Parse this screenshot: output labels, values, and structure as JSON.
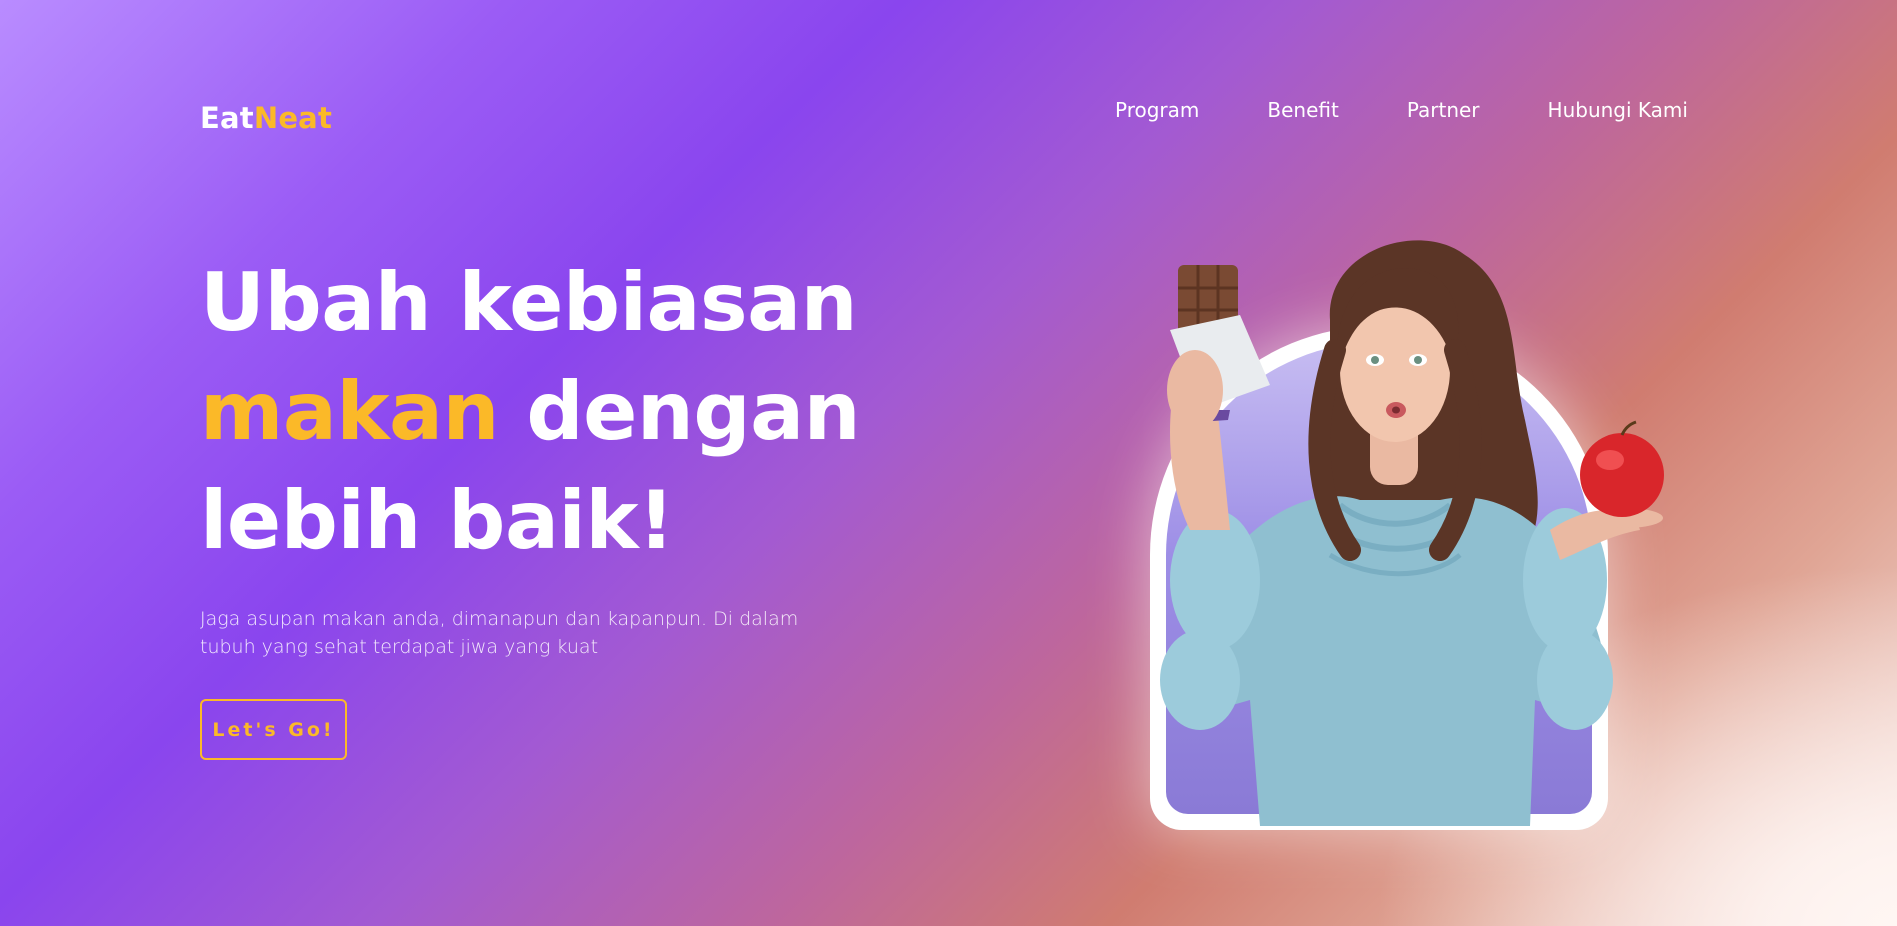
{
  "brand": {
    "part1": "Eat",
    "part2": "Neat"
  },
  "nav": {
    "items": [
      {
        "label": "Program"
      },
      {
        "label": "Benefit"
      },
      {
        "label": "Partner"
      },
      {
        "label": "Hubungi Kami"
      }
    ]
  },
  "hero": {
    "headline_line1": "Ubah kebiasan",
    "headline_highlight": "makan",
    "headline_line2_rest": " dengan",
    "headline_line3": "lebih baik!",
    "subtext": "Jaga asupan makan anda, dimanapun dan kapanpun. Di dalam tubuh yang sehat terdapat jiwa yang kuat",
    "cta_label": "Let's Go!",
    "image_description_icon": "woman-holding-chocolate-and-apple-image"
  },
  "colors": {
    "accent": "#fbb928",
    "text": "#ffffff",
    "gradient_start": "#b98cff",
    "gradient_mid": "#8a45ee",
    "gradient_warm": "#d07c70",
    "gradient_end": "#f6e6e3"
  }
}
